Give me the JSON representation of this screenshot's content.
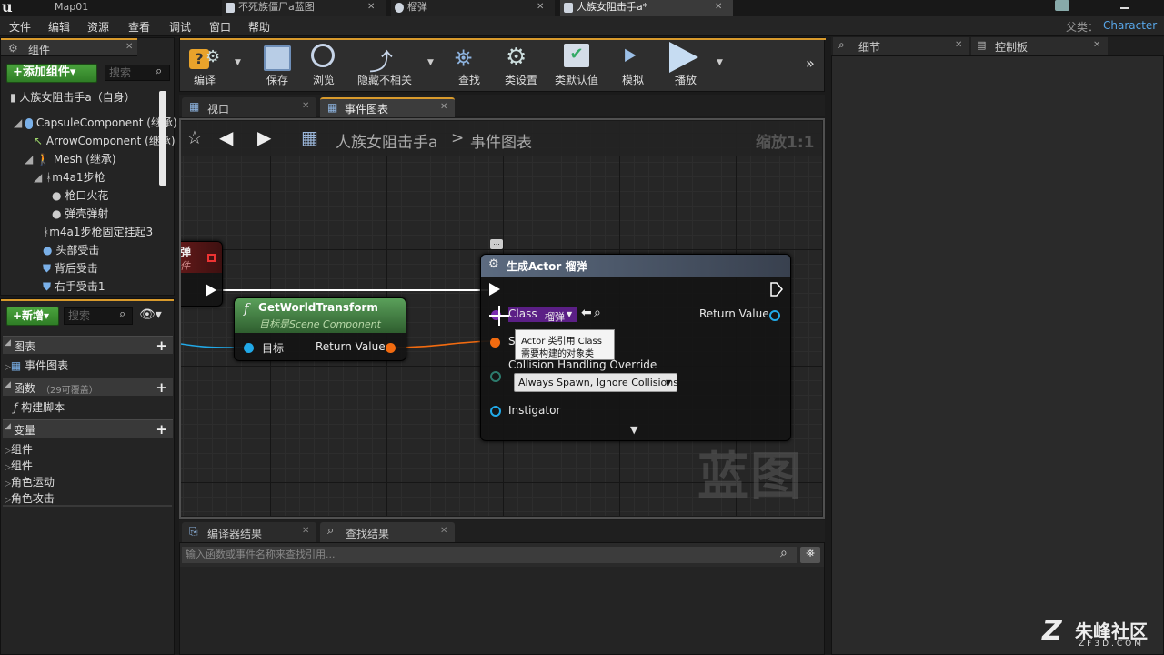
{
  "titlebar": {
    "tabs": [
      "Map01",
      "不死族僵尸a蓝图",
      "榴弹",
      "人族女阻击手a*"
    ]
  },
  "menubar": {
    "items": [
      "文件",
      "编辑",
      "资源",
      "查看",
      "调试",
      "窗口",
      "帮助"
    ],
    "parent_label": "父类：",
    "parent_value": "Character"
  },
  "components": {
    "title": "组件",
    "add_button": "+添加组件▾",
    "search_placeholder": "搜索",
    "self": "人族女阻击手a（自身）",
    "tree": [
      "CapsuleComponent (继承)",
      "ArrowComponent (继承)",
      "Mesh (继承)",
      "m4a1步枪",
      "枪口火花",
      "弹壳弹射",
      "m4a1步枪固定挂起3",
      "头部受击",
      "背后受击",
      "右手受击1"
    ]
  },
  "mybp": {
    "new_button": "+新增▾",
    "search_placeholder": "搜索",
    "graphs_title": "图表",
    "event_graph": "事件图表",
    "functions_title": "函数",
    "functions_count": "（29可覆盖）",
    "construction": "构建脚本",
    "variables_title": "变量",
    "var_groups": [
      "组件",
      "组件",
      "角色运动",
      "角色攻击"
    ]
  },
  "toolbar": {
    "items": [
      "编译",
      "保存",
      "浏览",
      "隐藏不相关",
      "查找",
      "类设置",
      "类默认值",
      "模拟",
      "播放"
    ]
  },
  "editor_tabs": {
    "viewport": "视口",
    "event_graph": "事件图表"
  },
  "graph": {
    "breadcrumb_bp": "人族女阻击手a",
    "breadcrumb_sep": ">",
    "breadcrumb_graph": "事件图表",
    "zoom": "缩放1:1",
    "watermark": "蓝图",
    "node_event_title": "弹",
    "node_event_sub": "件",
    "node_gwt": {
      "title": "GetWorldTransform",
      "subtitle": "目标是Scene Component",
      "pin_target": "目标",
      "pin_return": "Return Value"
    },
    "node_spawn": {
      "title": "生成Actor 榴弹",
      "pin_class": "Class",
      "class_value": "榴弹",
      "pin_return": "Return Value",
      "pin_spawn": "S",
      "pin_collision": "Collision Handling Override",
      "collision_value": "Always Spawn, Ignore Collisions",
      "pin_instigator": "Instigator"
    },
    "tooltip": [
      "Actor 类引用 Class",
      "需要构建的对象类"
    ]
  },
  "right": {
    "details_tab": "细节",
    "control_tab": "控制板"
  },
  "bottom": {
    "compiler_tab": "编译器结果",
    "find_tab": "查找结果",
    "find_placeholder": "输入函数或事件名称来查找引用..."
  },
  "watermark": {
    "brand": "朱峰社区",
    "url": "ZF3D.COM"
  },
  "colors": {
    "accent_green": "#3c9432",
    "exec_white": "#ffffff",
    "pin_blue": "#21a9e8",
    "pin_orange": "#f26b10",
    "class_purple": "#5b1f86"
  }
}
